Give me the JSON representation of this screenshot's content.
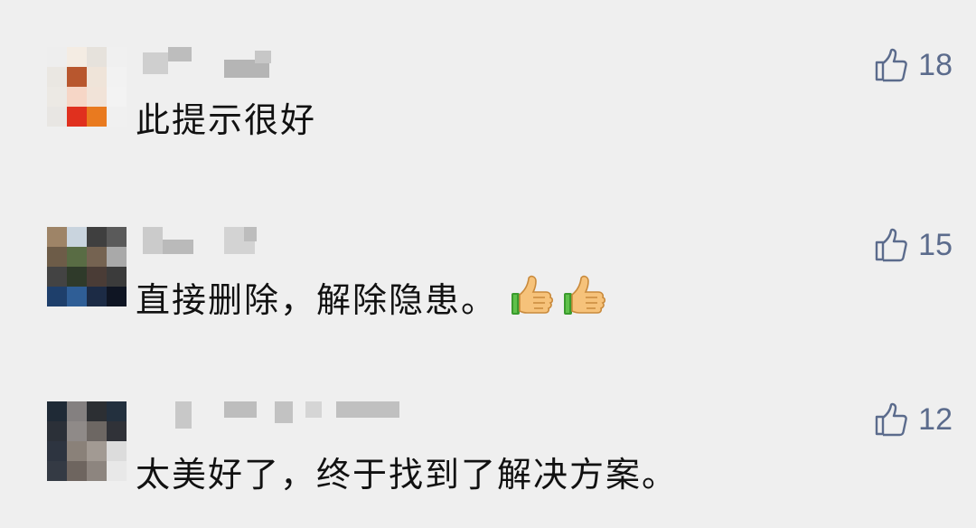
{
  "comments": [
    {
      "text": "此提示很好",
      "likes": "18",
      "has_emoji": false,
      "avatar_colors": [
        "#eeeeee",
        "#f4ece3",
        "#e6e2dc",
        "#f0f0f0",
        "#eae7e2",
        "#b8572e",
        "#efe4d9",
        "#f2f2f2",
        "#ece9e4",
        "#f6d6c6",
        "#f1e3d8",
        "#f3f3f3",
        "#e8e6e3",
        "#e0301e",
        "#e97a1f",
        "#f0f0f0"
      ]
    },
    {
      "text": "直接删除，解除隐患。",
      "likes": "15",
      "has_emoji": true,
      "emoji_name": "thumbs-up",
      "avatar_colors": [
        "#9e8467",
        "#c9d4de",
        "#3f3f3f",
        "#5a5a5a",
        "#6d5c48",
        "#596c44",
        "#756351",
        "#a9a9a9",
        "#434343",
        "#2f3a2a",
        "#4a3c36",
        "#3b3b3b",
        "#1e3f6b",
        "#2f5e96",
        "#1c2b45",
        "#0f1523"
      ]
    },
    {
      "text": "太美好了，终于找到了解决方案。",
      "likes": "12",
      "has_emoji": false,
      "avatar_colors": [
        "#1f2a36",
        "#848080",
        "#2c2f33",
        "#23303e",
        "#2b3038",
        "#8f8a88",
        "#6d6763",
        "#303238",
        "#2d3440",
        "#8a8179",
        "#a29a93",
        "#dcdcdc",
        "#343a44",
        "#6e655f",
        "#8d857f",
        "#e8e8e8"
      ]
    }
  ],
  "colors": {
    "background": "#efefef",
    "text": "#111111",
    "like": "#5b6b8c"
  }
}
